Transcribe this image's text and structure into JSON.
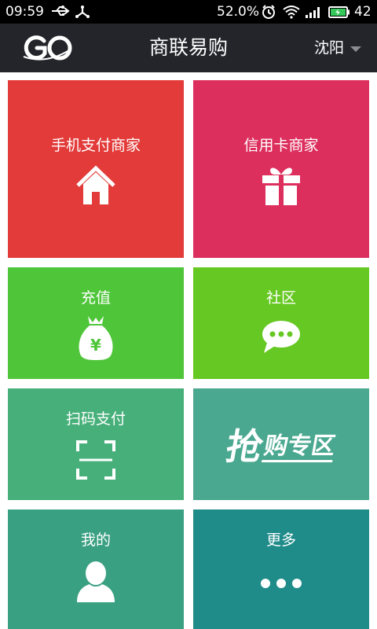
{
  "status_bar": {
    "time": "09:59",
    "battery_percent": "52.0%",
    "battery_number": "42",
    "icons": [
      "usb-icon",
      "fork-icon",
      "alarm-icon",
      "wifi-icon",
      "signal-icon",
      "battery-charging-icon"
    ]
  },
  "header": {
    "app_title": "商联易购",
    "logo_text": "GO",
    "city": "沈阳"
  },
  "tiles": {
    "mobile_pay": {
      "label": "手机支付商家",
      "icon": "home-icon",
      "color": "#e23b39"
    },
    "credit_card": {
      "label": "信用卡商家",
      "icon": "gift-icon",
      "color": "#dd2f5e"
    },
    "recharge": {
      "label": "充值",
      "icon": "money-bag-icon",
      "color": "#4fc63a"
    },
    "community": {
      "label": "社区",
      "icon": "chat-bubble-icon",
      "color": "#66c822"
    },
    "scan_pay": {
      "label": "扫码支付",
      "icon": "scan-frame-icon",
      "color": "#47b07a"
    },
    "flash_sale": {
      "big": "抢",
      "small": "购专区",
      "color": "#4aa890"
    },
    "mine": {
      "label": "我的",
      "icon": "user-icon",
      "color": "#3aa082"
    },
    "more": {
      "label": "更多",
      "icon": "more-dots-icon",
      "color": "#1f8c8a"
    }
  }
}
